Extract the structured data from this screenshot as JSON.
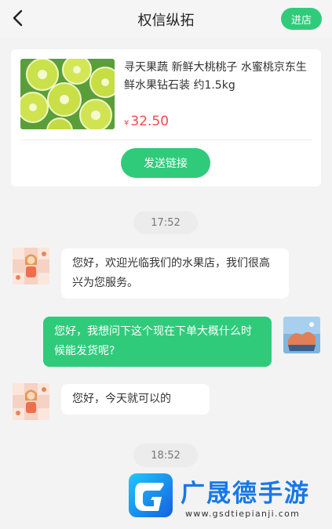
{
  "header": {
    "title": "权信纵拓",
    "store_button": "进店"
  },
  "product": {
    "title": "寻天果蔬 新鲜大桃桃子 水蜜桃京东生鲜水果钻石装 约1.5kg",
    "currency": "¥",
    "price": "32.50",
    "send_link_button": "发送链接"
  },
  "messages": [
    {
      "type": "time",
      "text": "17:52"
    },
    {
      "type": "in",
      "text": "您好，欢迎光临我们的水果店，我们很高兴为您服务。"
    },
    {
      "type": "out",
      "text": "您好，我想问下这个现在下单大概什么时候能发货呢?"
    },
    {
      "type": "in",
      "text": "您好，今天就可以的"
    },
    {
      "type": "time",
      "text": "18:52"
    }
  ],
  "watermark": {
    "name": "广晟德手游",
    "url": "www.gsdtiepianji.com"
  },
  "colors": {
    "accent": "#2fcb7b",
    "price": "#f04c4c",
    "background": "#f3f3f3"
  }
}
